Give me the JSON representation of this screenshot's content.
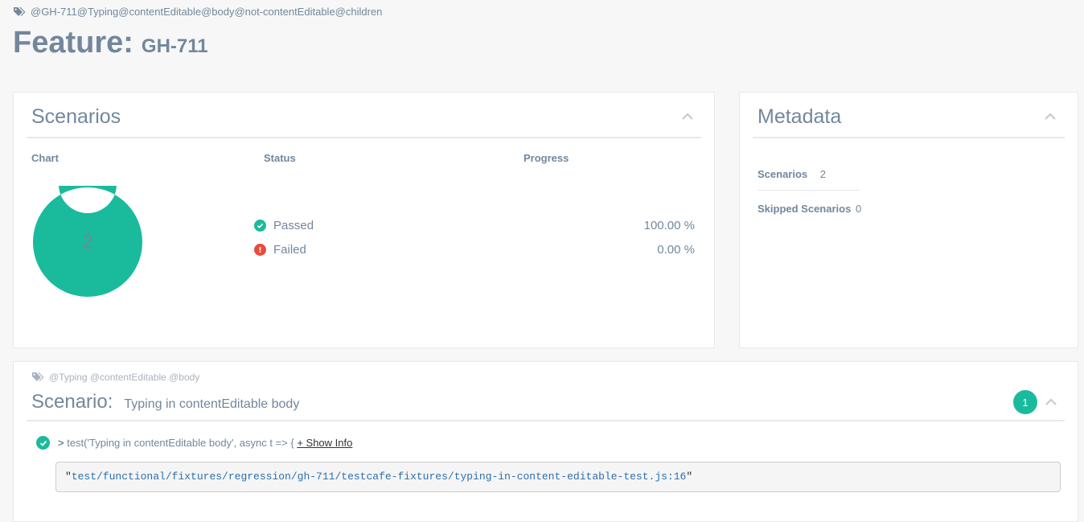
{
  "feature": {
    "tags": "@GH-711@Typing@contentEditable@body@not-contentEditable@children",
    "label": "Feature:",
    "name": "GH-711"
  },
  "scenarios_panel": {
    "title": "Scenarios",
    "columns": {
      "chart": "Chart",
      "status": "Status",
      "progress": "Progress"
    },
    "total": "2",
    "statuses": [
      {
        "label": "Passed",
        "progress": "100.00 %",
        "color": "#1abb9c",
        "icon": "check-circle-icon"
      },
      {
        "label": "Failed",
        "progress": "0.00 %",
        "color": "#e74c3c",
        "icon": "exclamation-circle-icon"
      }
    ],
    "chart_data": {
      "type": "pie",
      "categories": [
        "Passed",
        "Failed"
      ],
      "values": [
        2,
        0
      ],
      "center_label": "2",
      "colors": [
        "#1abb9c",
        "#e74c3c"
      ]
    }
  },
  "metadata_panel": {
    "title": "Metadata",
    "rows": [
      {
        "key": "Scenarios",
        "value": "2"
      },
      {
        "key": "Skipped Scenarios",
        "value": "0"
      }
    ]
  },
  "scenario": {
    "tags": "@Typing @contentEditable @body",
    "label": "Scenario:",
    "name": "Typing in contentEditable body",
    "badge_count": "1",
    "step": {
      "keyword": ">",
      "text": "test('Typing in contentEditable body', async t => {",
      "show_info": "+ Show Info"
    },
    "location": "test/functional/fixtures/regression/gh-711/testcafe-fixtures/typing-in-content-editable-test.js:16"
  },
  "colors": {
    "accent": "#1abb9c",
    "danger": "#e74c3c",
    "text": "#73879c"
  }
}
